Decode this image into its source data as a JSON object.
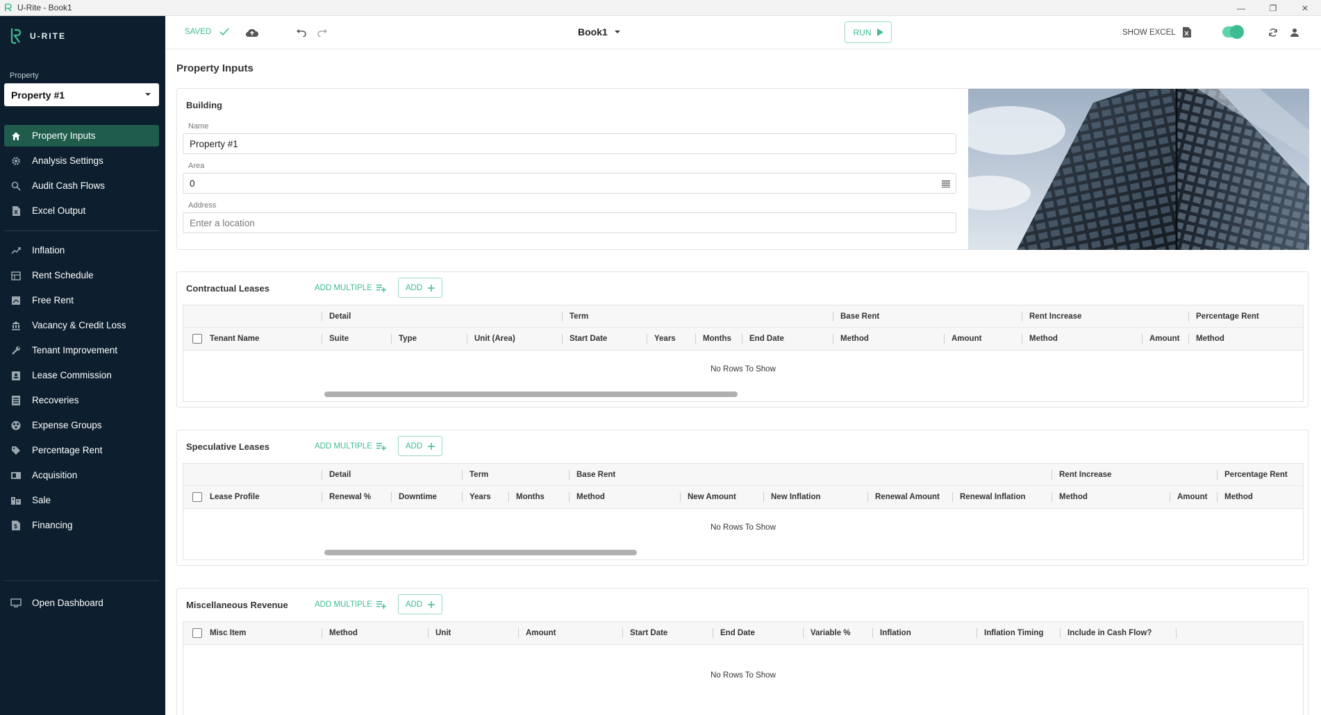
{
  "window": {
    "title": "U-Rite - Book1"
  },
  "sidebar": {
    "logo_text": "U-RITE",
    "property_label": "Property",
    "property_value": "Property #1",
    "items": [
      {
        "label": "Property Inputs",
        "icon": "home-icon",
        "active": true
      },
      {
        "label": "Analysis Settings",
        "icon": "gear-icon"
      },
      {
        "label": "Audit Cash Flows",
        "icon": "search-icon"
      },
      {
        "label": "Excel Output",
        "icon": "excel-file-icon"
      },
      {
        "label": "Inflation",
        "icon": "trending-up-icon"
      },
      {
        "label": "Rent Schedule",
        "icon": "rent-schedule-icon"
      },
      {
        "label": "Free Rent",
        "icon": "free-rent-icon"
      },
      {
        "label": "Vacancy & Credit Loss",
        "icon": "bank-icon"
      },
      {
        "label": "Tenant Improvement",
        "icon": "wrench-icon"
      },
      {
        "label": "Lease Commission",
        "icon": "badge-icon"
      },
      {
        "label": "Recoveries",
        "icon": "list-icon"
      },
      {
        "label": "Expense Groups",
        "icon": "group-icon"
      },
      {
        "label": "Percentage Rent",
        "icon": "tag-icon"
      },
      {
        "label": "Acquisition",
        "icon": "acquisition-icon"
      },
      {
        "label": "Sale",
        "icon": "sale-icon"
      },
      {
        "label": "Financing",
        "icon": "financing-icon"
      }
    ],
    "dashboard_label": "Open Dashboard"
  },
  "toolbar": {
    "saved_label": "SAVED",
    "book_name": "Book1",
    "run_label": "RUN",
    "show_excel_label": "SHOW EXCEL",
    "toggle_on": true
  },
  "page": {
    "title": "Property Inputs",
    "building": {
      "title": "Building",
      "name_label": "Name",
      "name_value": "Property #1",
      "area_label": "Area",
      "area_value": "0",
      "address_label": "Address",
      "address_placeholder": "Enter a location"
    },
    "add_multiple_label": "ADD MULTIPLE",
    "add_label": "ADD",
    "no_rows": "No Rows To Show",
    "contractual": {
      "title": "Contractual Leases",
      "groups": [
        "Detail",
        "Term",
        "Base Rent",
        "Rent Increase",
        "Percentage Rent"
      ],
      "columns": [
        "Tenant Name",
        "Suite",
        "Type",
        "Unit (Area)",
        "Start Date",
        "Years",
        "Months",
        "End Date",
        "Method",
        "Amount",
        "Method",
        "Amount",
        "Method"
      ]
    },
    "speculative": {
      "title": "Speculative Leases",
      "groups": [
        "Detail",
        "Term",
        "Base Rent",
        "Rent Increase",
        "Percentage Rent"
      ],
      "columns": [
        "Lease Profile",
        "Renewal %",
        "Downtime",
        "Years",
        "Months",
        "Method",
        "New Amount",
        "New Inflation",
        "Renewal Amount",
        "Renewal Inflation",
        "Method",
        "Amount",
        "Method"
      ]
    },
    "misc": {
      "title": "Miscellaneous Revenue",
      "columns": [
        "Misc Item",
        "Method",
        "Unit",
        "Amount",
        "Start Date",
        "End Date",
        "Variable %",
        "Inflation",
        "Inflation Timing",
        "Include in Cash Flow?"
      ]
    }
  },
  "colors": {
    "sidebar_bg": "#0d1f2e",
    "accent": "#3dbb91",
    "active_item": "#1f5c4c"
  }
}
